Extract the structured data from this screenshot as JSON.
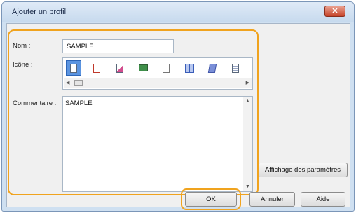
{
  "dialog": {
    "title": "Ajouter un profil",
    "close_glyph": "✕"
  },
  "form": {
    "name_label": "Nom :",
    "name_value": "SAMPLE",
    "icon_label": "Icône :",
    "comment_label": "Commentaire :",
    "comment_value": "SAMPLE"
  },
  "icons": [
    "document-icon",
    "document-red-icon",
    "document-pink-icon",
    "photo-icon",
    "document-gray-icon",
    "book-icon",
    "document-blue-icon",
    "document-text-icon"
  ],
  "buttons": {
    "settings": "Affichage des paramètres",
    "ok": "OK",
    "cancel": "Annuler",
    "help": "Aide"
  },
  "colors": {
    "highlight": "#f0a31e",
    "selected_icon": "#5b94e0"
  }
}
